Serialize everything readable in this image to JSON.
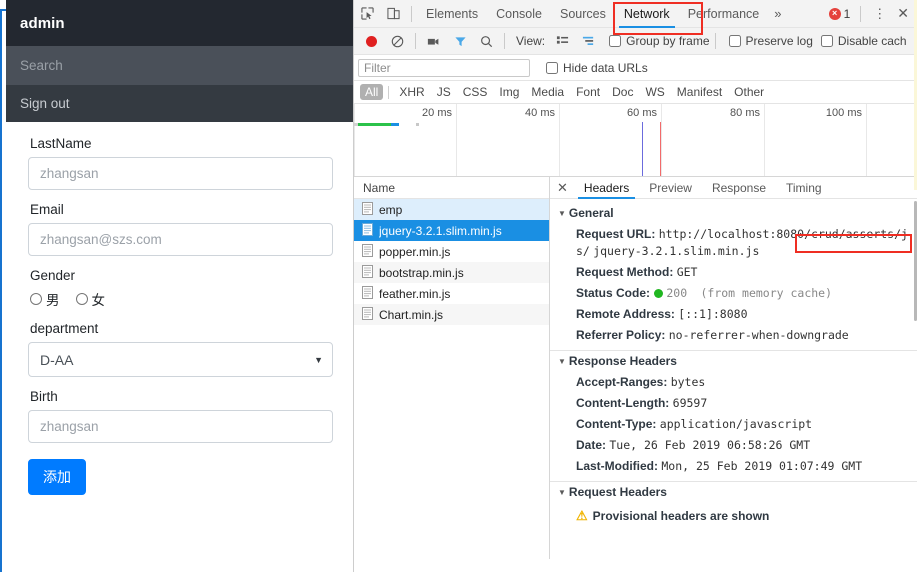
{
  "page": {
    "navbar": {
      "brand": "admin"
    },
    "search": {
      "placeholder": "Search",
      "value": ""
    },
    "signout": {
      "label": "Sign out"
    },
    "form": {
      "fields": [
        {
          "label": "LastName",
          "placeholder": "zhangsan",
          "value": "",
          "type": "text"
        },
        {
          "label": "Email",
          "placeholder": "zhangsan@szs.com",
          "value": "",
          "type": "text"
        }
      ],
      "gender": {
        "label": "Gender",
        "options": [
          {
            "label": "男",
            "checked": false
          },
          {
            "label": "女",
            "checked": false
          }
        ]
      },
      "department": {
        "label": "department",
        "selected": "D-AA",
        "caret": "▼"
      },
      "birth": {
        "label": "Birth",
        "placeholder": "zhangsan",
        "value": ""
      },
      "submit": {
        "label": "添加"
      }
    }
  },
  "devtools": {
    "toolbar": {
      "icons": [
        {
          "name": "inspect-element-icon",
          "glyph": "inspect"
        },
        {
          "name": "device-toolbar-icon",
          "glyph": "device"
        }
      ],
      "tabs": [
        {
          "label": "Elements",
          "active": false
        },
        {
          "label": "Console",
          "active": false
        },
        {
          "label": "Sources",
          "active": false
        },
        {
          "label": "Network",
          "active": true
        },
        {
          "label": "Performance",
          "active": false
        }
      ],
      "more_tabs": "»",
      "error_badge": {
        "glyph": "×",
        "count": "1"
      },
      "kebab": "⋮",
      "close": "✕",
      "accent_color": "#1a8fe3",
      "highlight_color": "#ef2e23"
    },
    "controls": {
      "record_tooltip": "record",
      "clear_tooltip": "clear",
      "capture_screenshots_tooltip": "camera",
      "filter_tooltip": "filter",
      "search_tooltip": "search",
      "view_label": "View:",
      "checkboxes": [
        {
          "label": "Group by frame",
          "checked": false
        },
        {
          "label": "Preserve log",
          "checked": false
        },
        {
          "label": "Disable cach",
          "checked": false
        }
      ]
    },
    "filter_row": {
      "placeholder": "Filter",
      "value": "",
      "hide_data_urls": {
        "label": "Hide data URLs",
        "checked": false
      }
    },
    "type_filters": [
      {
        "label": "All",
        "selected": true
      },
      {
        "label": "XHR",
        "selected": false
      },
      {
        "label": "JS",
        "selected": false
      },
      {
        "label": "CSS",
        "selected": false
      },
      {
        "label": "Img",
        "selected": false
      },
      {
        "label": "Media",
        "selected": false
      },
      {
        "label": "Font",
        "selected": false
      },
      {
        "label": "Doc",
        "selected": false
      },
      {
        "label": "WS",
        "selected": false
      },
      {
        "label": "Manifest",
        "selected": false
      },
      {
        "label": "Other",
        "selected": false
      }
    ],
    "overview": {
      "ticks": [
        "20 ms",
        "40 ms",
        "60 ms",
        "80 ms",
        "100 ms"
      ],
      "event_lines": [
        {
          "color": "#6b6bdd",
          "label": "DOMContentLoaded"
        },
        {
          "color": "#f26a6a",
          "label": "Load"
        }
      ]
    },
    "requests": {
      "column_header": "Name",
      "rows": [
        {
          "name": "emp",
          "state": "hover"
        },
        {
          "name": "jquery-3.2.1.slim.min.js",
          "state": "selected"
        },
        {
          "name": "popper.min.js",
          "state": "normal"
        },
        {
          "name": "bootstrap.min.js",
          "state": "zebra"
        },
        {
          "name": "feather.min.js",
          "state": "normal"
        },
        {
          "name": "Chart.min.js",
          "state": "zebra"
        }
      ]
    },
    "detail": {
      "tabs": [
        {
          "label": "Headers",
          "active": true
        },
        {
          "label": "Preview",
          "active": false
        },
        {
          "label": "Response",
          "active": false
        },
        {
          "label": "Timing",
          "active": false
        }
      ],
      "close_glyph": "✕",
      "sections": [
        {
          "title": "General",
          "expanded": true,
          "rows": [
            {
              "key": "Request URL:",
              "value_prefix": "http://localhost:8080",
              "value_highlight": "/crud/asserts/js/",
              "value_suffix": "jquery-3.2.1.slim.min.js",
              "highlighted": true
            },
            {
              "key": "Request Method:",
              "value": "GET"
            },
            {
              "key": "Status Code:",
              "value": "200",
              "status_ok": true,
              "value_note": "(from memory cache)"
            },
            {
              "key": "Remote Address:",
              "value": "[::1]:8080"
            },
            {
              "key": "Referrer Policy:",
              "value": "no-referrer-when-downgrade"
            }
          ]
        },
        {
          "title": "Response Headers",
          "expanded": true,
          "rows": [
            {
              "key": "Accept-Ranges:",
              "value": "bytes"
            },
            {
              "key": "Content-Length:",
              "value": "69597"
            },
            {
              "key": "Content-Type:",
              "value": "application/javascript"
            },
            {
              "key": "Date:",
              "value": "Tue, 26 Feb 2019 06:58:26 GMT"
            },
            {
              "key": "Last-Modified:",
              "value": "Mon, 25 Feb 2019 01:07:49 GMT"
            }
          ]
        },
        {
          "title": "Request Headers",
          "expanded": true,
          "warning": {
            "glyph": "⚠",
            "text": "Provisional headers are shown"
          },
          "rows": []
        }
      ]
    }
  }
}
